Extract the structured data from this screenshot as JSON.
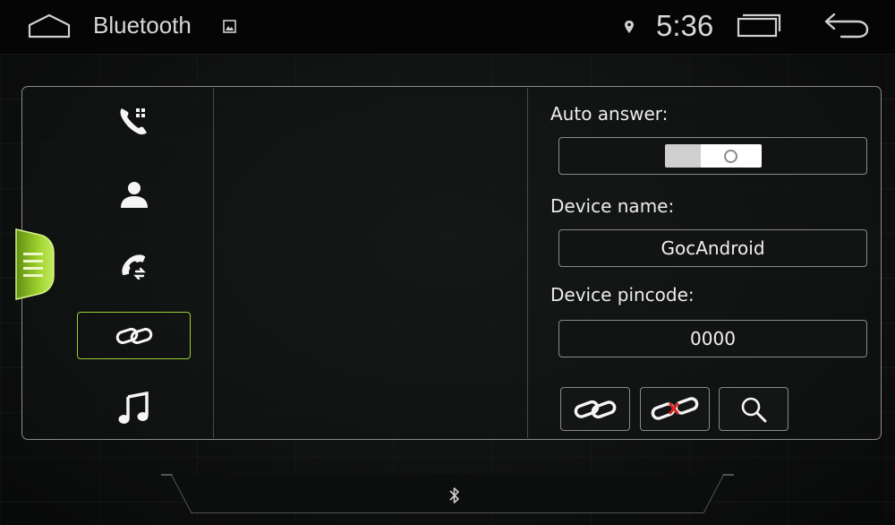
{
  "statusbar": {
    "title": "Bluetooth",
    "time": "5:36",
    "icons": [
      "home-icon",
      "image-icon",
      "location-icon",
      "recent-apps-icon",
      "back-icon"
    ]
  },
  "nav": {
    "items": [
      {
        "id": "dialpad",
        "icon": "phone-dialpad-icon"
      },
      {
        "id": "contacts",
        "icon": "contact-icon"
      },
      {
        "id": "call-log",
        "icon": "call-log-icon"
      },
      {
        "id": "pairing",
        "icon": "link-icon",
        "active": true
      },
      {
        "id": "music",
        "icon": "music-note-icon"
      }
    ]
  },
  "settings": {
    "auto_answer_label": "Auto answer:",
    "auto_answer_on": false,
    "device_name_label": "Device name:",
    "device_name": "GocAndroid",
    "device_pincode_label": "Device pincode:",
    "device_pincode": "0000"
  },
  "actions": [
    {
      "id": "connect",
      "icon": "link-icon"
    },
    {
      "id": "disconnect",
      "icon": "unlink-icon"
    },
    {
      "id": "search",
      "icon": "search-icon"
    }
  ],
  "colors": {
    "accent": "#9acd32",
    "border": "#8a8a8a",
    "background": "#0b0c0c"
  }
}
